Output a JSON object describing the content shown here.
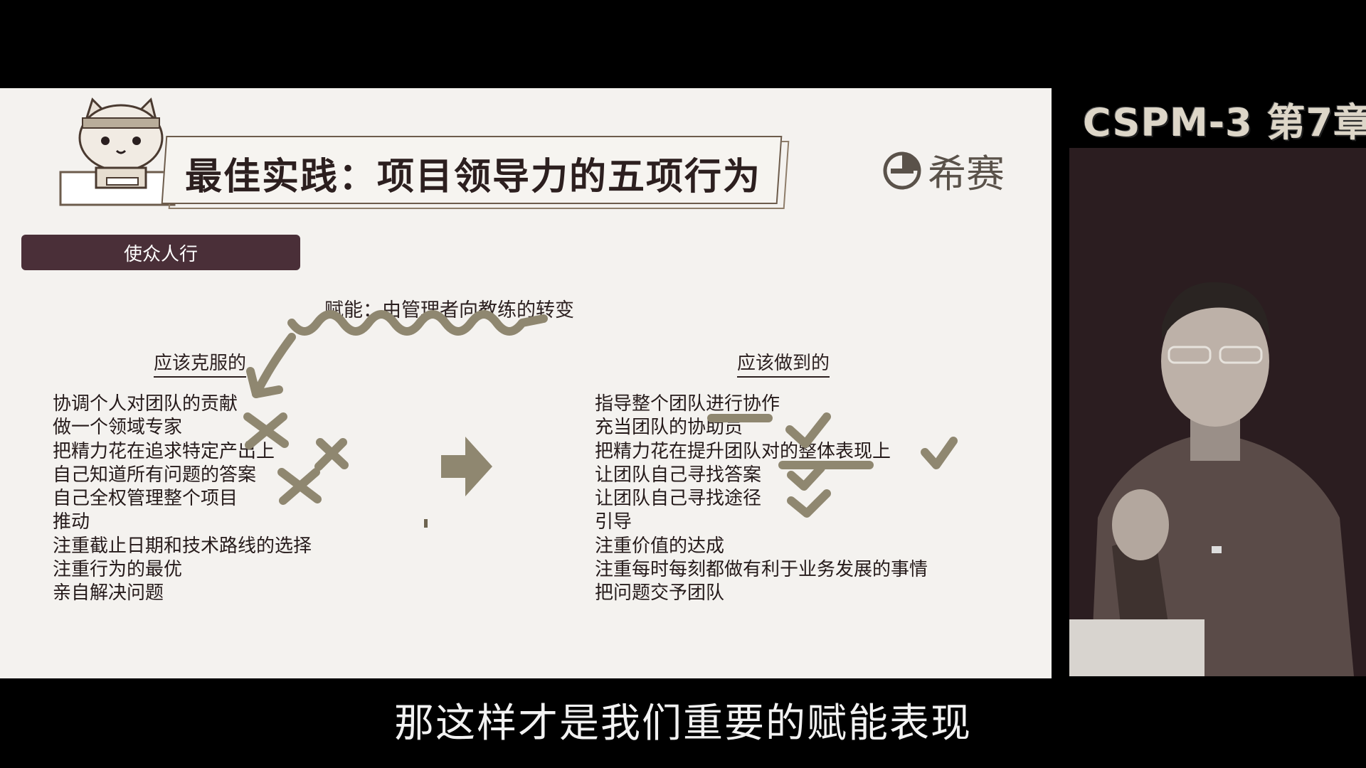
{
  "slide": {
    "title": "最佳实践：项目领导力的五项行为",
    "brand_name": "希赛",
    "section_label": "使众人行",
    "subtitle": "赋能：由管理者向教练的转变",
    "left_heading": "应该克服的",
    "left_items": [
      "协调个人对团队的贡献",
      "做一个领域专家",
      "把精力花在追求特定产出上",
      "自己知道所有问题的答案",
      "自己全权管理整个项目",
      "推动",
      "注重截止日期和技术路线的选择",
      "注重行为的最优",
      "亲自解决问题"
    ],
    "right_heading": "应该做到的",
    "right_items": [
      "指导整个团队进行协作",
      "充当团队的协助员",
      "把精力花在提升团队对的整体表现上",
      "让团队自己寻找答案",
      "让团队自己寻找途径",
      "引导",
      "注重价值的达成",
      "注重每时每刻都做有利于业务发展的事情",
      "把问题交予团队"
    ]
  },
  "overlay": {
    "chapter_label": "CSPM-3 第7章"
  },
  "caption": {
    "text": "那这样才是我们重要的赋能表现"
  },
  "colors": {
    "background": "#000000",
    "slide_bg": "#f4f2ef",
    "pill_bg": "#4a2f38",
    "annotation": "#8f8770",
    "text": "#251a1a"
  }
}
